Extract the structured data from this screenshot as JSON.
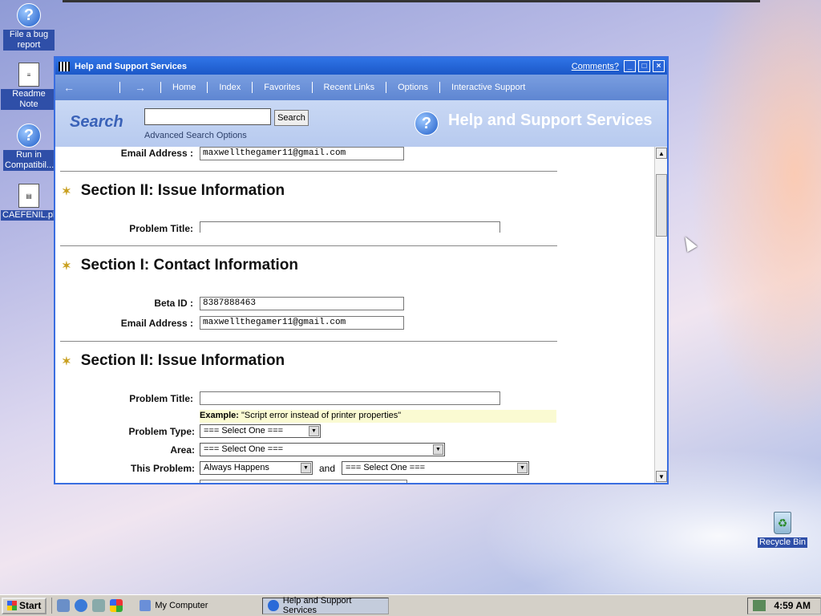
{
  "desktop": {
    "icons": [
      {
        "label": "File a bug report",
        "icon": "help-question-icon"
      },
      {
        "label": "Readme Note",
        "icon": "document-icon"
      },
      {
        "label": "Run in Compatibil...",
        "icon": "help-question-icon"
      },
      {
        "label": "CAEFENIL.ph",
        "icon": "file-icon"
      },
      {
        "label": "Recycle Bin",
        "icon": "recycle-bin-icon"
      }
    ]
  },
  "window": {
    "title": "Help and Support Services",
    "comments_link": "Comments?",
    "buttons": {
      "minimize": "_",
      "maximize": "□",
      "close": "×"
    },
    "nav": {
      "back": "←",
      "forward": "→",
      "items": [
        "Home",
        "Index",
        "Favorites",
        "Recent Links",
        "Options",
        "Interactive Support"
      ]
    },
    "search": {
      "label": "Search",
      "button": "Search",
      "advanced": "Advanced Search Options",
      "value": ""
    },
    "brand": "Help and Support Services"
  },
  "form": {
    "email_label": "Email Address :",
    "email_value": "maxwellthegamer11@gmail.com",
    "section2_title": "Section II: Issue Information",
    "problem_title_label": "Problem Title:",
    "section1_title": "Section I: Contact Information",
    "beta_id_label": "Beta ID :",
    "beta_id_value": "8387888463",
    "example_prefix": "Example:",
    "example_text": " \"Script error instead of printer properties\"",
    "problem_type_label": "Problem Type:",
    "problem_type_value": "=== Select One ===",
    "area_label": "Area:",
    "area_value": "=== Select One ===",
    "this_problem_label": "This Problem:",
    "this_problem_value": "Always Happens",
    "and_label": "and",
    "this_problem_value2": "=== Select One ==="
  },
  "taskbar": {
    "start": "Start",
    "tasks": [
      "My Computer",
      "Help and Support Services"
    ],
    "clock": "4:59 AM"
  },
  "colors": {
    "titlebar": "#1c58c8",
    "navbar": "#6a8fd8",
    "searchbar": "#c2d3f2",
    "taskbar": "#d4d0c8"
  }
}
